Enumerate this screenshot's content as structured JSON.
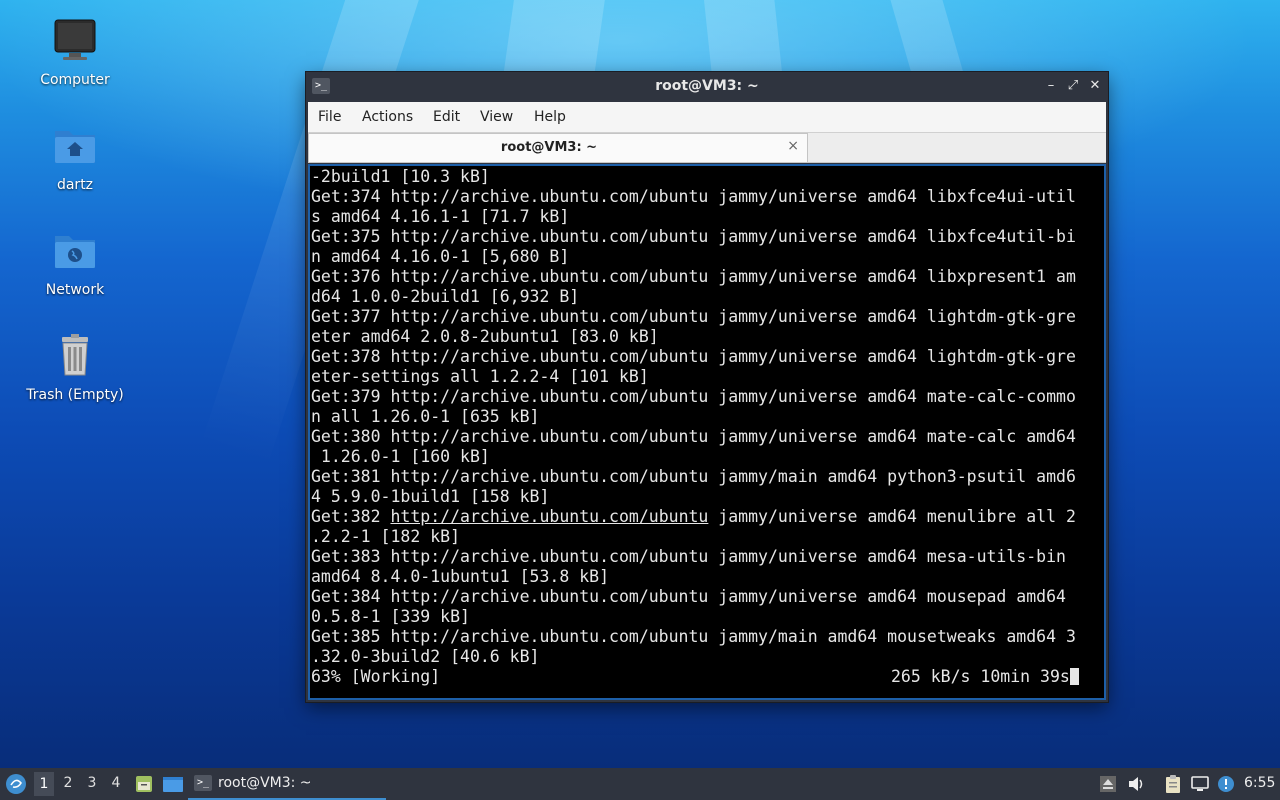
{
  "desktop": {
    "icons": [
      {
        "label": "Computer"
      },
      {
        "label": "dartz"
      },
      {
        "label": "Network"
      },
      {
        "label": "Trash (Empty)"
      }
    ]
  },
  "window": {
    "title": "root@VM3: ~",
    "menu": [
      "File",
      "Actions",
      "Edit",
      "View",
      "Help"
    ],
    "tab_label": "root@VM3: ~",
    "tab_close": "×",
    "buttons": {
      "minimize": "–",
      "maximize": "⤢",
      "close": "✕"
    }
  },
  "terminal": {
    "lines": [
      "-2build1 [10.3 kB]",
      "Get:374 http://archive.ubuntu.com/ubuntu jammy/universe amd64 libxfce4ui-util",
      "s amd64 4.16.1-1 [71.7 kB]",
      "Get:375 http://archive.ubuntu.com/ubuntu jammy/universe amd64 libxfce4util-bi",
      "n amd64 4.16.0-1 [5,680 B]",
      "Get:376 http://archive.ubuntu.com/ubuntu jammy/universe amd64 libxpresent1 am",
      "d64 1.0.0-2build1 [6,932 B]",
      "Get:377 http://archive.ubuntu.com/ubuntu jammy/universe amd64 lightdm-gtk-gre",
      "eter amd64 2.0.8-2ubuntu1 [83.0 kB]",
      "Get:378 http://archive.ubuntu.com/ubuntu jammy/universe amd64 lightdm-gtk-gre",
      "eter-settings all 1.2.2-4 [101 kB]",
      "Get:379 http://archive.ubuntu.com/ubuntu jammy/universe amd64 mate-calc-commo",
      "n all 1.26.0-1 [635 kB]",
      "Get:380 http://archive.ubuntu.com/ubuntu jammy/universe amd64 mate-calc amd64",
      " 1.26.0-1 [160 kB]",
      "Get:381 http://archive.ubuntu.com/ubuntu jammy/main amd64 python3-psutil amd6",
      "4 5.9.0-1build1 [158 kB]",
      null,
      ".2.2-1 [182 kB]",
      "Get:383 http://archive.ubuntu.com/ubuntu jammy/universe amd64 mesa-utils-bin",
      "amd64 8.4.0-1ubuntu1 [53.8 kB]",
      "Get:384 http://archive.ubuntu.com/ubuntu jammy/universe amd64 mousepad amd64",
      "0.5.8-1 [339 kB]",
      "Get:385 http://archive.ubuntu.com/ubuntu jammy/main amd64 mousetweaks amd64 3",
      ".32.0-3build2 [40.6 kB]"
    ],
    "link_line": {
      "prefix": "Get:382 ",
      "link": "http://archive.ubuntu.com/ubuntu",
      "suffix": " jammy/universe amd64 menulibre all 2"
    },
    "status_left": "63% [Working]",
    "status_right": "265 kB/s 10min 39s"
  },
  "taskbar": {
    "workspaces": [
      "1",
      "2",
      "3",
      "4"
    ],
    "active_workspace": "1",
    "task_label": "root@VM3: ~",
    "clock": "6:55"
  }
}
